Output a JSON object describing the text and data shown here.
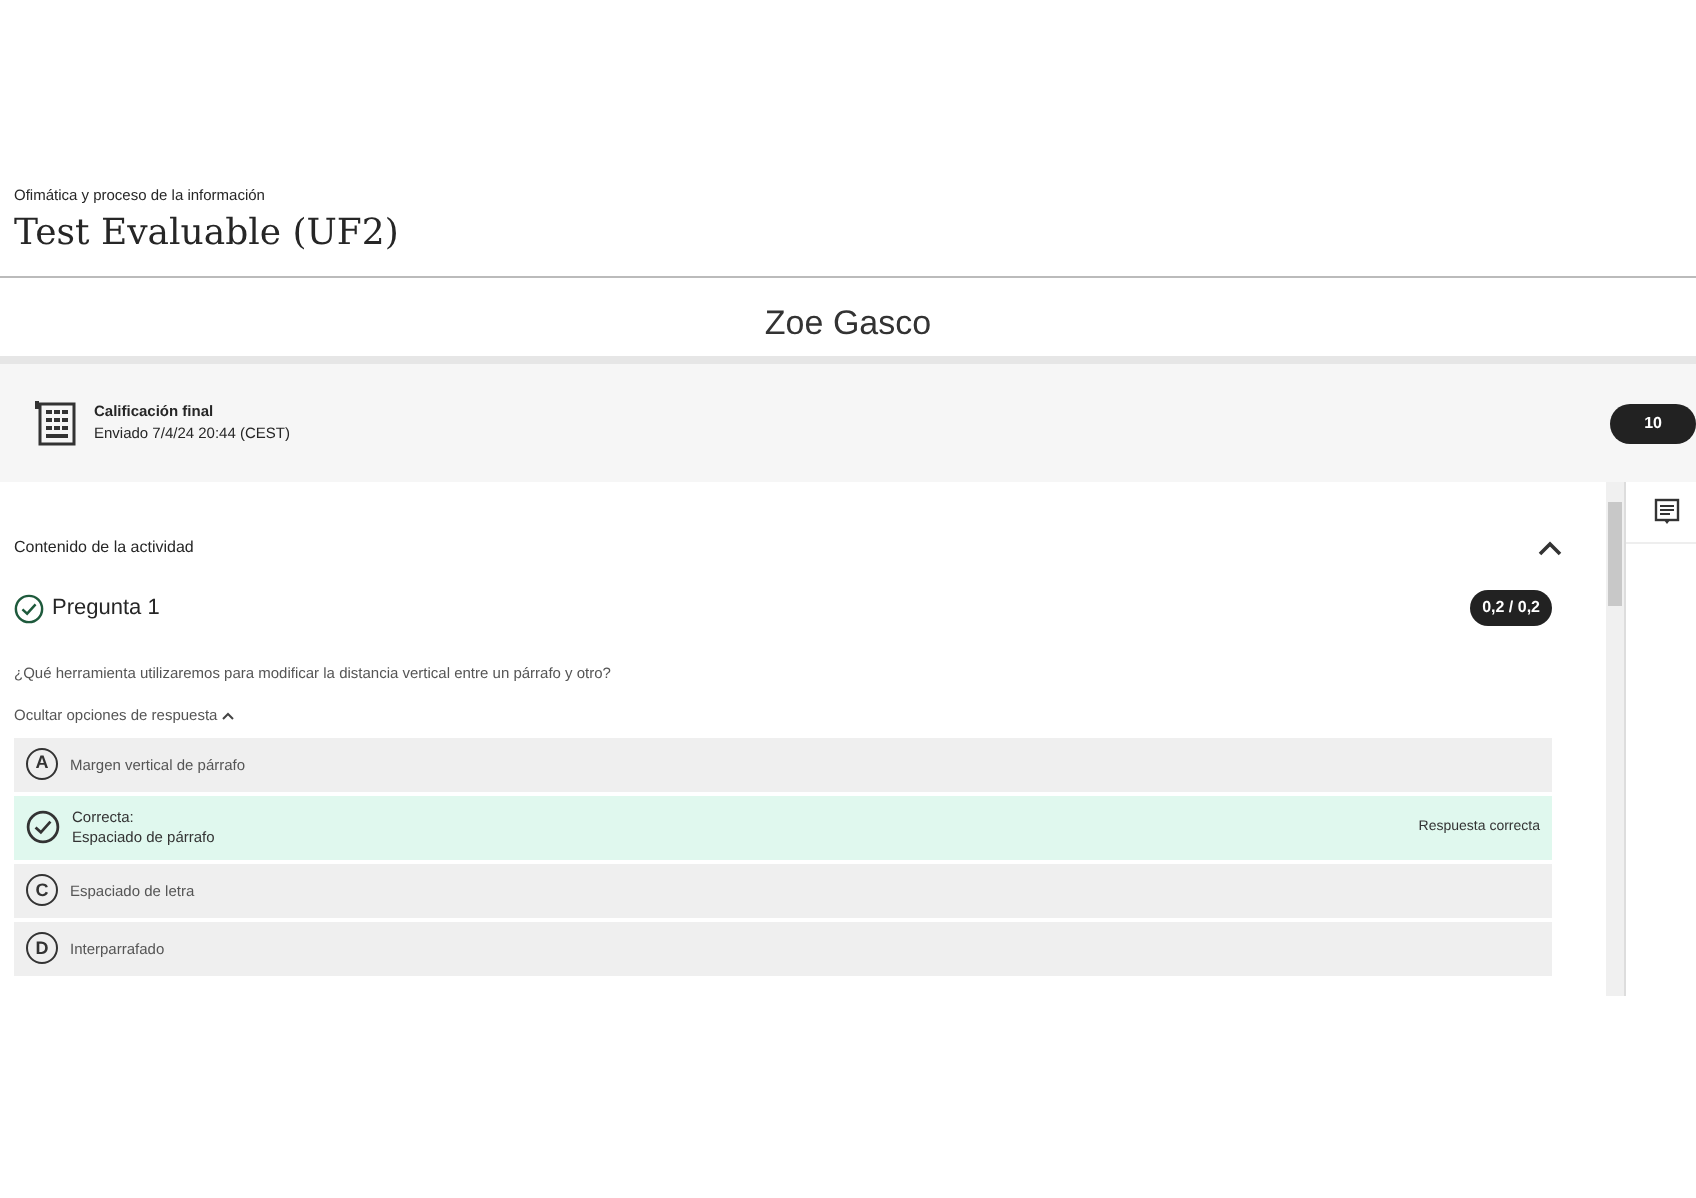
{
  "header": {
    "breadcrumb": "Ofimática y proceso de la información",
    "title": "Test Evaluable (UF2)"
  },
  "student": {
    "name": "Zoe Gasco"
  },
  "grade": {
    "title": "Calificación final",
    "submitted": "Enviado 7/4/24 20:44 (CEST)",
    "score": "10"
  },
  "activity": {
    "title": "Contenido de la actividad",
    "expanded": true,
    "question": {
      "title": "Pregunta 1",
      "correct": true,
      "score": "0,2 / 0,2",
      "text": "¿Qué herramienta utilizaremos para modificar la distancia vertical entre un párrafo y otro?",
      "toggle": "Ocultar opciones de respuesta",
      "options": [
        {
          "kind": "letter",
          "letter": "A",
          "text": "Margen vertical de párrafo"
        },
        {
          "kind": "correct",
          "label": "Correcta:",
          "text": "Espaciado de párrafo",
          "note": "Respuesta correcta"
        },
        {
          "kind": "letter",
          "letter": "C",
          "text": "Espaciado de letra"
        },
        {
          "kind": "letter",
          "letter": "D",
          "text": "Interparrafado"
        }
      ]
    }
  }
}
